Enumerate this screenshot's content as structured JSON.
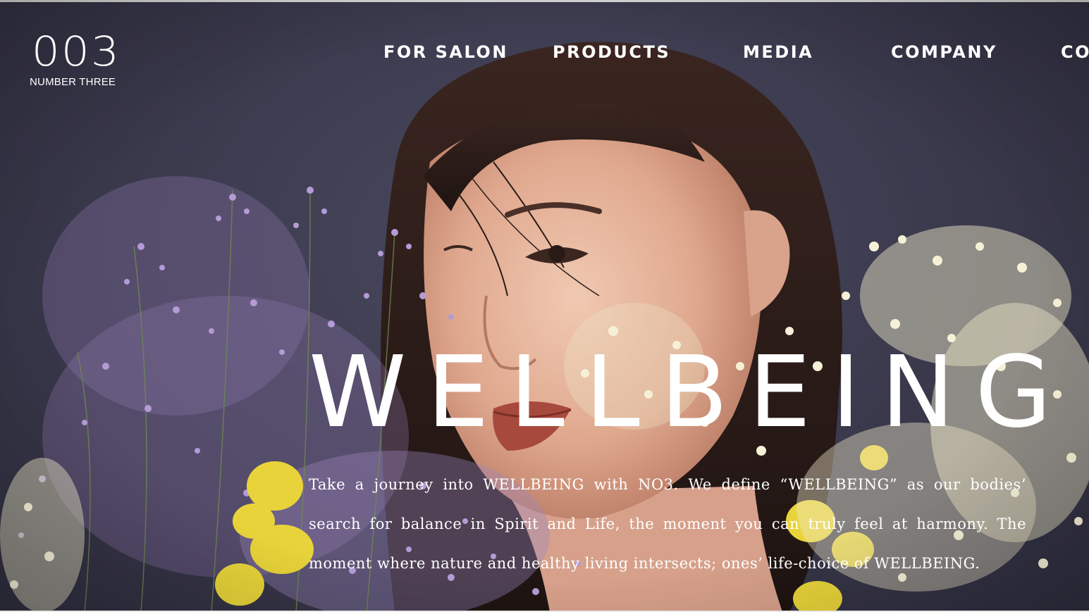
{
  "brand": {
    "mark": "003",
    "subtitle": "NUMBER THREE"
  },
  "nav": {
    "items": [
      {
        "label": "FOR SALON"
      },
      {
        "label": "PRODUCTS"
      },
      {
        "label": "MEDIA"
      },
      {
        "label": "COMPANY"
      },
      {
        "label": "CO"
      }
    ]
  },
  "hero": {
    "headline": "WELLBEING",
    "body": "Take a journey into WELLBEING with NO3. We define “WELLBEING” as our bodies’ search for balance in Spirit and Life, the moment you can truly feel at harmony. The moment where nature and healthy living intersects; ones’ life-choice of WELLBEING."
  },
  "colors": {
    "background": "#3c3b4f",
    "text": "#ffffff",
    "flower_purple": "#a68cc8",
    "flower_yellow": "#e8d43a",
    "flower_cream": "#efe9c9"
  }
}
